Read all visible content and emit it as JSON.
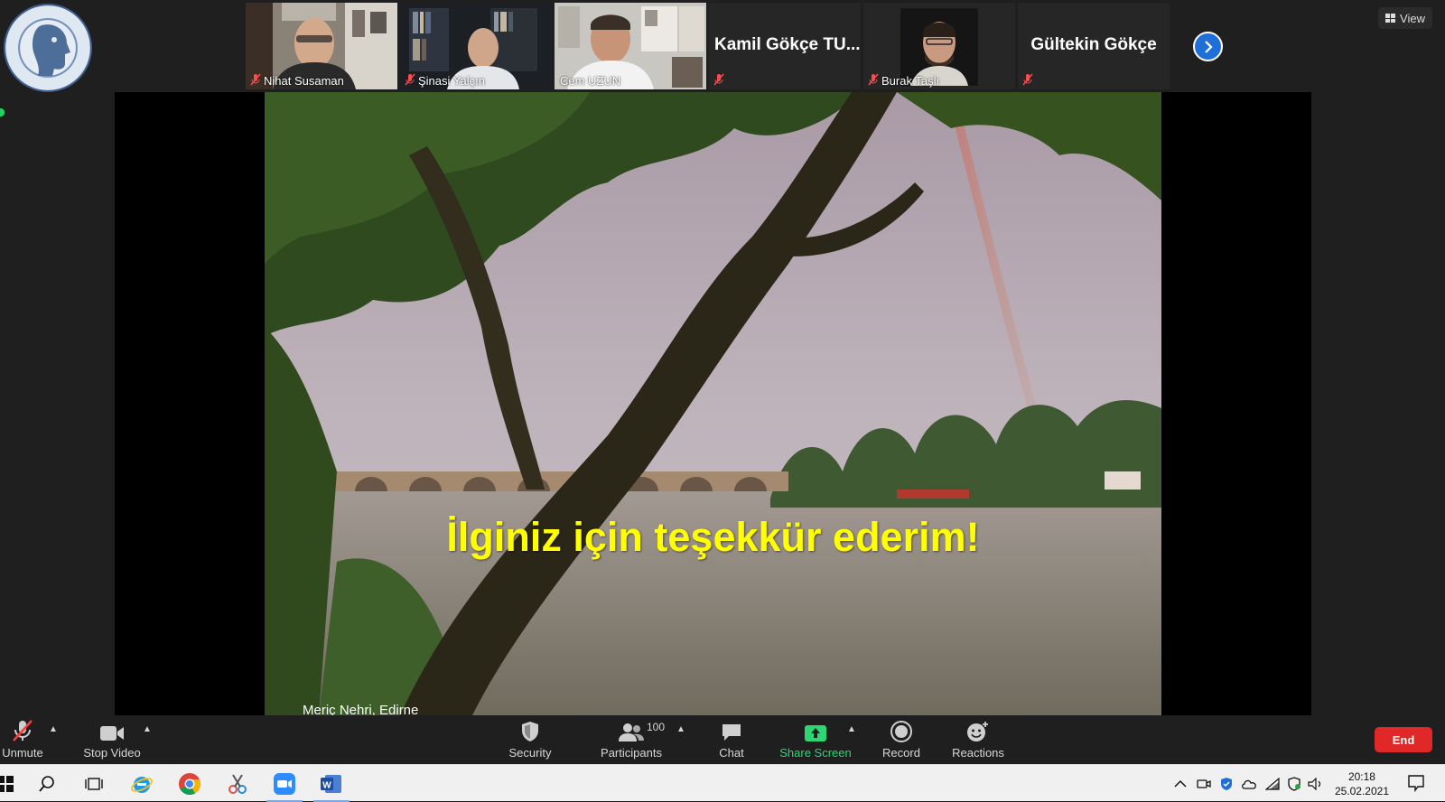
{
  "header": {
    "view_label": "View"
  },
  "participants": [
    {
      "name": "Nihat Susaman",
      "has_video": true,
      "muted": true
    },
    {
      "name": "Şinasi Yalçın",
      "has_video": true,
      "muted": true
    },
    {
      "name": "Cem UZUN",
      "has_video": true,
      "muted": false,
      "active_speaker": true
    },
    {
      "name": "Kamil Gökçe TU...",
      "has_video": false,
      "muted": true
    },
    {
      "name": "Burak Taşlı",
      "has_video": true,
      "muted": true
    },
    {
      "name": "Gültekin Gökçe",
      "has_video": false,
      "muted": true
    }
  ],
  "slide": {
    "title": "İlginiz için teşekkür ederim!",
    "caption": "Meriç Nehri, Edirne"
  },
  "toolbar": {
    "unmute": "Unmute",
    "stop_video": "Stop Video",
    "security": "Security",
    "participants": "Participants",
    "participants_count": "100",
    "chat": "Chat",
    "share_screen": "Share Screen",
    "record": "Record",
    "reactions": "Reactions",
    "end": "End"
  },
  "taskbar": {
    "time": "20:18",
    "date": "25.02.2021"
  },
  "colors": {
    "accent_blue": "#1f6fd8",
    "share_green": "#2ed573",
    "end_red": "#e02828",
    "slide_text": "#ffff00",
    "active_outline": "#9bd35a"
  }
}
